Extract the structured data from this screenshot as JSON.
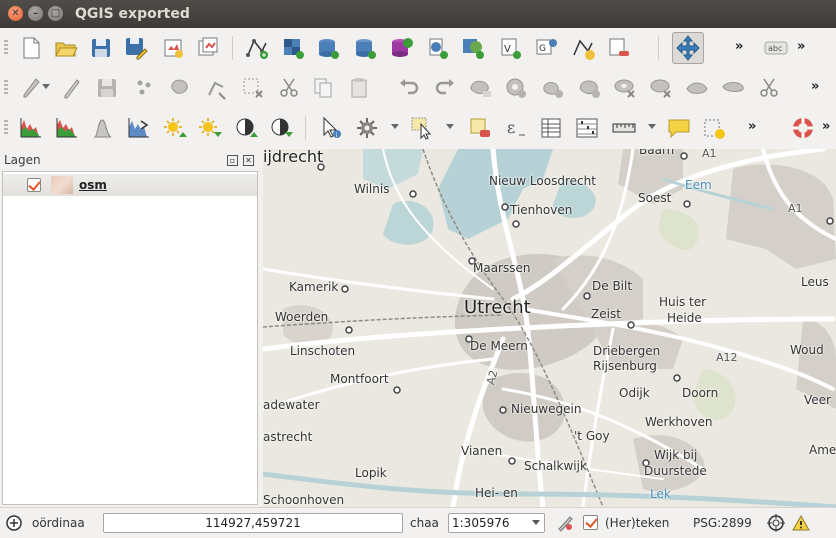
{
  "window": {
    "title": "QGIS exported"
  },
  "toolbars": {
    "row1": [
      "new-project",
      "open-project",
      "save-project",
      "save-project-as",
      "new-print-composer",
      "composer-manager",
      "new-vector-layer",
      "add-raster-layer",
      "add-postgis-layer",
      "add-spatialite-layer",
      "add-mssql-layer",
      "add-oracle-layer",
      "add-wms-layer",
      "add-wcs-layer",
      "add-wfs-layer",
      "add-delimited-text-layer",
      "remove-layer",
      "pan-map"
    ],
    "row1_more": "»",
    "row1_label_icon": "abc",
    "row1_more2": "»",
    "row2": [
      "current-edits",
      "toggle-editing",
      "save-layer-edits",
      "add-feature",
      "move-feature",
      "node-tool",
      "delete-selected",
      "cut-features",
      "copy-features",
      "paste-features",
      "undo",
      "redo",
      "simplify-feature",
      "add-ring",
      "add-part",
      "fill-ring",
      "delete-ring",
      "delete-part",
      "reshape",
      "offset-curve",
      "split-features",
      "split-parts",
      "merge-features"
    ],
    "row2_more": "»",
    "row3": [
      "histogram-stretch",
      "local-stretch",
      "cumulative-cut",
      "full-dataset-stretch",
      "increase-brightness",
      "decrease-brightness",
      "increase-contrast",
      "decrease-contrast",
      "identify-features",
      "action",
      "select-features",
      "deselect-all",
      "field-calculator",
      "open-attribute-table",
      "statistics",
      "measure-line",
      "map-tips",
      "new-bookmark",
      "help-contents"
    ],
    "row3_more": "»",
    "row3_more2": "»"
  },
  "layers_panel": {
    "title": "Lagen",
    "layers": [
      {
        "name": "osm",
        "checked": true
      }
    ]
  },
  "map": {
    "places": [
      {
        "name": "ijdrecht",
        "size": "big"
      },
      {
        "name": "Wilnis",
        "size": "normal"
      },
      {
        "name": "Nieuw Loosdrecht",
        "size": "normal"
      },
      {
        "name": "Baarn",
        "size": "normal"
      },
      {
        "name": "A1",
        "size": "road"
      },
      {
        "name": "Eem",
        "size": "water"
      },
      {
        "name": "Soest",
        "size": "normal"
      },
      {
        "name": "A1",
        "size": "road"
      },
      {
        "name": "Tienhoven",
        "size": "normal"
      },
      {
        "name": "Maarssen",
        "size": "normal"
      },
      {
        "name": "Kamerik",
        "size": "normal"
      },
      {
        "name": "Utrecht",
        "size": "big"
      },
      {
        "name": "De Bilt",
        "size": "normal"
      },
      {
        "name": "Huis ter",
        "size": "normal"
      },
      {
        "name": "Heide",
        "size": "normal"
      },
      {
        "name": "Leus",
        "size": "normal"
      },
      {
        "name": "Woerden",
        "size": "normal"
      },
      {
        "name": "Zeist",
        "size": "normal"
      },
      {
        "name": "De Meern",
        "size": "normal"
      },
      {
        "name": "Linschoten",
        "size": "normal"
      },
      {
        "name": "Driebergen",
        "size": "normal"
      },
      {
        "name": "A12",
        "size": "road"
      },
      {
        "name": "Woud",
        "size": "normal"
      },
      {
        "name": "Rijsenburg",
        "size": "normal"
      },
      {
        "name": "Montfoort",
        "size": "normal"
      },
      {
        "name": "A2",
        "size": "road"
      },
      {
        "name": "Odijk",
        "size": "normal"
      },
      {
        "name": "Doorn",
        "size": "normal"
      },
      {
        "name": "adewater",
        "size": "normal"
      },
      {
        "name": "Nieuwegein",
        "size": "normal"
      },
      {
        "name": "Veer",
        "size": "normal"
      },
      {
        "name": "Werkhoven",
        "size": "normal"
      },
      {
        "name": "astrecht",
        "size": "normal"
      },
      {
        "name": "'t Goy",
        "size": "normal"
      },
      {
        "name": "Vianen",
        "size": "normal"
      },
      {
        "name": "Wijk bij",
        "size": "normal"
      },
      {
        "name": "Amer",
        "size": "normal"
      },
      {
        "name": "Schalkwijk",
        "size": "normal"
      },
      {
        "name": "Duurstede",
        "size": "normal"
      },
      {
        "name": "Lopik",
        "size": "normal"
      },
      {
        "name": "Hei- en",
        "size": "normal"
      },
      {
        "name": "Lek",
        "size": "water"
      },
      {
        "name": "Schoonhoven",
        "size": "normal"
      }
    ]
  },
  "statusbar": {
    "coord_label": "oördinaa",
    "coord_value": "114927,459721",
    "scale_label": "chaa",
    "scale_value": "1:305976",
    "render_label": "(Her)teken",
    "crs_label": "PSG:2899"
  },
  "colors": {
    "accent": "#e1572a",
    "map_bg": "#ebe8e1",
    "water": "#b5d0d0",
    "road": "#ffffff",
    "urban": "#d2cfc8"
  }
}
